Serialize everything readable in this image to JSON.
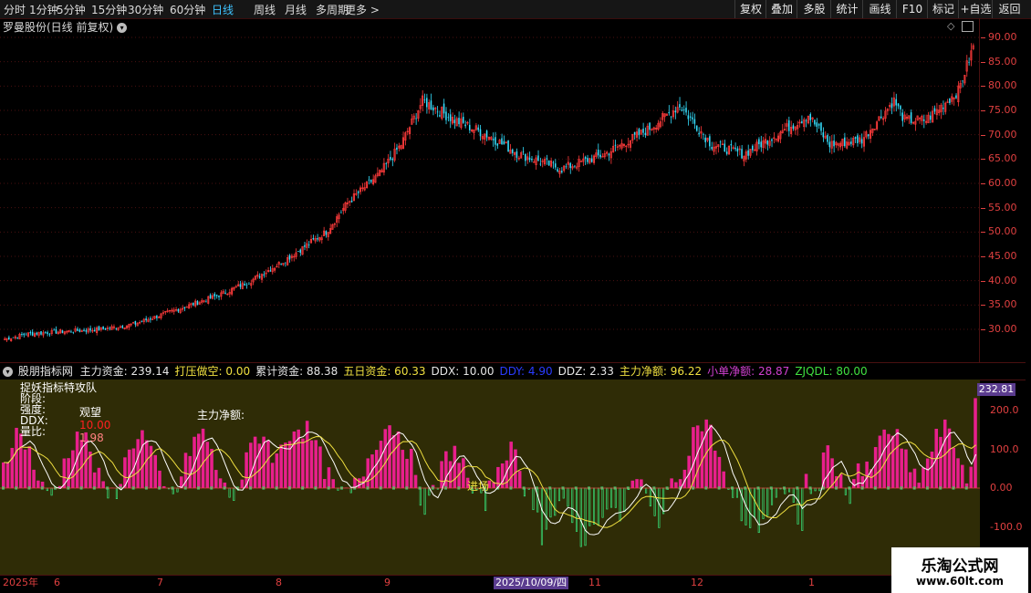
{
  "toolbar": {
    "periods": [
      "分时",
      "1分钟",
      "5分钟",
      "15分钟",
      "30分钟",
      "60分钟",
      "日线",
      "周线",
      "月线",
      "多周期",
      "更多 >"
    ],
    "active_period": "日线",
    "buttons": [
      "复权",
      "叠加",
      "多股",
      "统计",
      "画线",
      "F10",
      "标记",
      "+自选",
      "返回"
    ]
  },
  "stock": {
    "title": "罗曼股份(日线 前复权)"
  },
  "main_axis": {
    "ticks": [
      "90.00",
      "85.00",
      "80.00",
      "75.00",
      "70.00",
      "65.00",
      "60.00",
      "55.00",
      "50.00",
      "45.00",
      "40.00",
      "35.00",
      "30.00"
    ]
  },
  "indicator": {
    "name": "股朋指标网",
    "items": [
      {
        "label": "主力资金:",
        "value": "239.14",
        "color": "#e6e6e6"
      },
      {
        "label": "打压做空:",
        "value": "0.00",
        "color": "#f0e040"
      },
      {
        "label": "累计资金:",
        "value": "88.38",
        "color": "#e6e6e6"
      },
      {
        "label": "五日资金:",
        "value": "60.33",
        "color": "#f0e040"
      },
      {
        "label": "DDX:",
        "value": "10.00",
        "color": "#e6e6e6"
      },
      {
        "label": "DDY:",
        "value": "4.90",
        "color": "#2a3cff"
      },
      {
        "label": "DDZ:",
        "value": "2.33",
        "color": "#e6e6e6"
      },
      {
        "label": "主力净额:",
        "value": "96.22",
        "color": "#f0e040"
      },
      {
        "label": "小单净额:",
        "value": "28.87",
        "color": "#d040d0"
      },
      {
        "label": "ZJQDL:",
        "value": "80.00",
        "color": "#40e040"
      }
    ],
    "overlay": {
      "title": "捉妖指标特攻队",
      "stage_label": "阶段:",
      "strength_label": "强度:",
      "strength_value": "观望",
      "ddx_label": "DDX:",
      "ddx_value": "10.00",
      "ratio_label": "量比:",
      "ratio_value": "1.98",
      "net_label": "主力净额:",
      "entry_label": "进场"
    },
    "axis_ticks": [
      "200.0",
      "100.0",
      "0.00",
      "-100.0"
    ],
    "last_value": "232.81"
  },
  "dates": {
    "labels": [
      "2025年",
      "6",
      "7",
      "8",
      "9",
      "11",
      "12",
      "1"
    ],
    "cursor": "2025/10/09/四"
  },
  "watermark": {
    "line1": "乐淘公式网",
    "line2": "www.60lt.com"
  },
  "colors": {
    "up": "#ff3b3b",
    "down": "#35e0ff",
    "pink": "#e81f8c",
    "green": "#37e27a",
    "panel": "#2f2c06"
  },
  "chart_data": {
    "type": "candlestick",
    "title": "罗曼股份(日线 前复权)",
    "ylim": [
      26,
      92
    ],
    "close_anchors": [
      [
        0,
        28
      ],
      [
        10,
        29
      ],
      [
        25,
        29.5
      ],
      [
        45,
        30
      ],
      [
        60,
        31
      ],
      [
        80,
        34
      ],
      [
        100,
        37
      ],
      [
        115,
        40
      ],
      [
        130,
        44
      ],
      [
        140,
        47
      ],
      [
        150,
        50
      ],
      [
        160,
        56
      ],
      [
        175,
        62
      ],
      [
        185,
        68
      ],
      [
        195,
        77
      ],
      [
        210,
        73
      ],
      [
        225,
        70
      ],
      [
        240,
        66
      ],
      [
        260,
        63
      ],
      [
        280,
        66
      ],
      [
        300,
        71
      ],
      [
        315,
        76
      ],
      [
        330,
        68
      ],
      [
        345,
        66
      ],
      [
        360,
        70
      ],
      [
        375,
        74
      ],
      [
        385,
        68
      ],
      [
        400,
        69
      ],
      [
        415,
        77
      ],
      [
        420,
        73
      ],
      [
        430,
        73
      ],
      [
        445,
        79
      ],
      [
        452,
        88
      ]
    ],
    "volume_series": "主力资金"
  }
}
